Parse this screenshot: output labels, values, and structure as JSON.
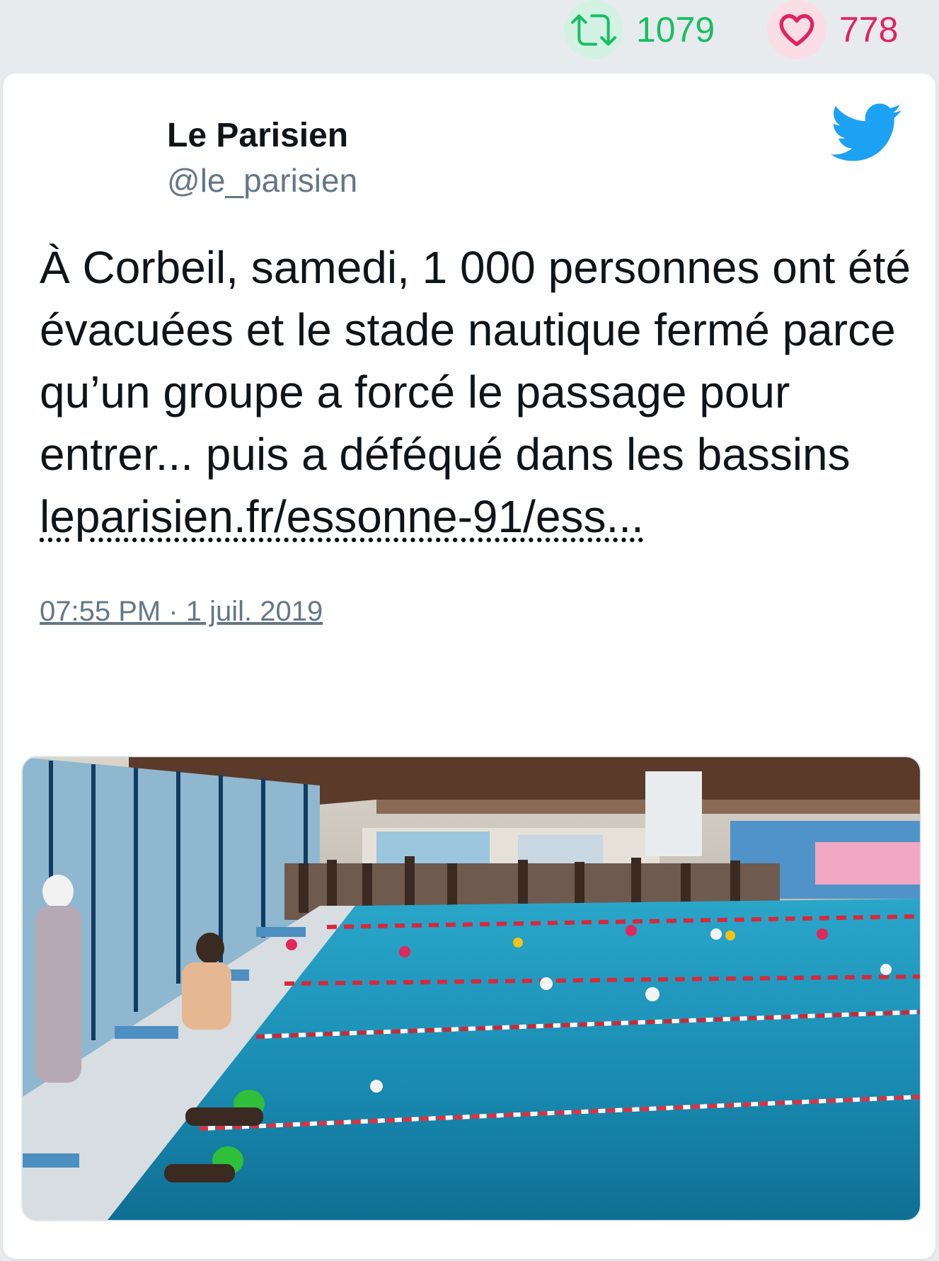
{
  "stats": {
    "retweets": "1079",
    "likes": "778",
    "retweet_color": "#17bf63",
    "like_color": "#e0245e"
  },
  "author": {
    "name": "Le Parisien",
    "handle": "@le_parisien"
  },
  "tweet": {
    "text": "À Corbeil, samedi, 1 000 personnes ont été évacuées et le stade nautique fermé parce qu’un groupe a forcé le passage pour entrer... puis a déféqué dans les bassins ",
    "link": "leparisien.fr/essonne-91/ess...",
    "timestamp": "07:55 PM · 1 juil. 2019"
  },
  "actions": [
    "reply-icon",
    "retweet-icon",
    "like-icon"
  ],
  "icons": {
    "brand": "twitter-bird-icon",
    "brand_color": "#1da1f2"
  }
}
